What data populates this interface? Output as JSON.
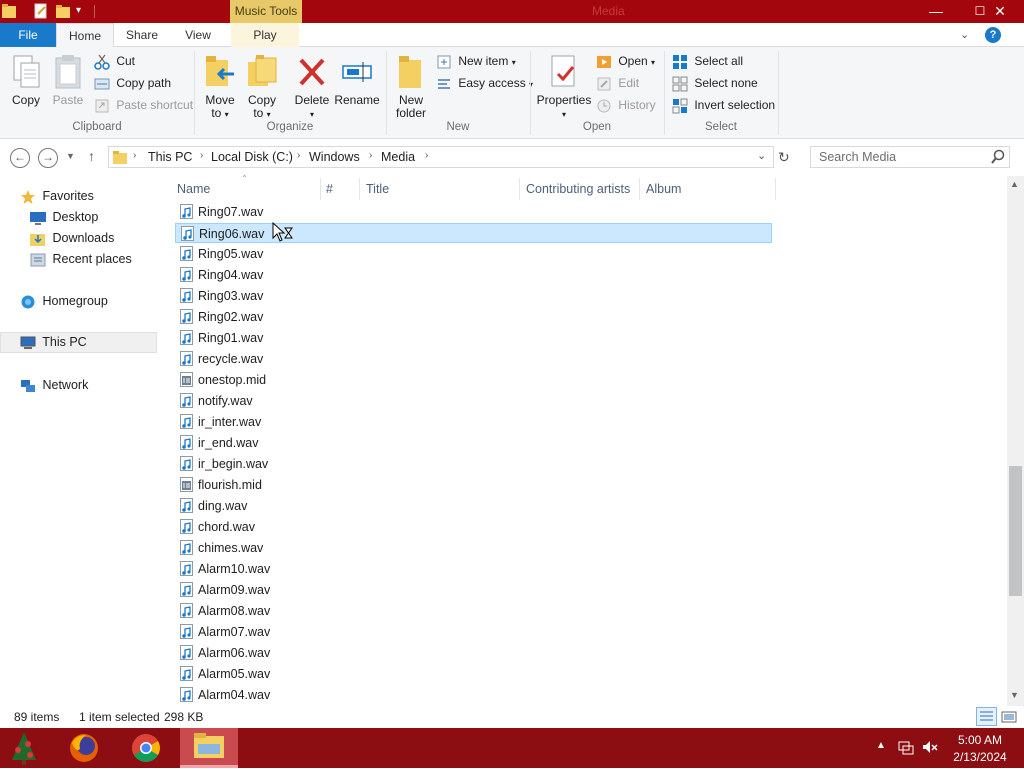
{
  "window": {
    "title": "Media",
    "contextual_tab_group": "Music Tools",
    "controls": {
      "minimize": "—",
      "maximize": "☐",
      "close": "✕"
    }
  },
  "ribbon_tabs": [
    "File",
    "Home",
    "Share",
    "View",
    "Play"
  ],
  "help_icon": "?",
  "ribbon": {
    "clipboard": {
      "label": "Clipboard",
      "copy": "Copy",
      "paste": "Paste",
      "cut": "Cut",
      "copy_path": "Copy path",
      "paste_shortcut": "Paste shortcut"
    },
    "organize": {
      "label": "Organize",
      "move_to": "Move",
      "move_to_2": "to",
      "copy_to": "Copy",
      "copy_to_2": "to",
      "delete": "Delete",
      "rename": "Rename"
    },
    "new": {
      "label": "New",
      "new_folder": "New",
      "new_folder_2": "folder",
      "new_item": "New item",
      "easy_access": "Easy access"
    },
    "open": {
      "label": "Open",
      "properties": "Properties",
      "open": "Open",
      "edit": "Edit",
      "history": "History"
    },
    "select": {
      "label": "Select",
      "select_all": "Select all",
      "select_none": "Select none",
      "invert_selection": "Invert selection"
    }
  },
  "address": {
    "breadcrumbs": [
      "This PC",
      "Local Disk (C:)",
      "Windows",
      "Media"
    ],
    "search_placeholder": "Search Media"
  },
  "nav": {
    "favorites": "Favorites",
    "desktop": "Desktop",
    "downloads": "Downloads",
    "recent_places": "Recent places",
    "homegroup": "Homegroup",
    "this_pc": "This PC",
    "network": "Network"
  },
  "columns": {
    "name": "Name",
    "number": "#",
    "title": "Title",
    "contributing_artists": "Contributing artists",
    "album": "Album"
  },
  "files": [
    {
      "name": "Ring07.wav",
      "type": "wav"
    },
    {
      "name": "Ring06.wav",
      "type": "wav",
      "selected": true
    },
    {
      "name": "Ring05.wav",
      "type": "wav"
    },
    {
      "name": "Ring04.wav",
      "type": "wav"
    },
    {
      "name": "Ring03.wav",
      "type": "wav"
    },
    {
      "name": "Ring02.wav",
      "type": "wav"
    },
    {
      "name": "Ring01.wav",
      "type": "wav"
    },
    {
      "name": "recycle.wav",
      "type": "wav"
    },
    {
      "name": "onestop.mid",
      "type": "mid"
    },
    {
      "name": "notify.wav",
      "type": "wav"
    },
    {
      "name": "ir_inter.wav",
      "type": "wav"
    },
    {
      "name": "ir_end.wav",
      "type": "wav"
    },
    {
      "name": "ir_begin.wav",
      "type": "wav"
    },
    {
      "name": "flourish.mid",
      "type": "mid"
    },
    {
      "name": "ding.wav",
      "type": "wav"
    },
    {
      "name": "chord.wav",
      "type": "wav"
    },
    {
      "name": "chimes.wav",
      "type": "wav"
    },
    {
      "name": "Alarm10.wav",
      "type": "wav"
    },
    {
      "name": "Alarm09.wav",
      "type": "wav"
    },
    {
      "name": "Alarm08.wav",
      "type": "wav"
    },
    {
      "name": "Alarm07.wav",
      "type": "wav"
    },
    {
      "name": "Alarm06.wav",
      "type": "wav"
    },
    {
      "name": "Alarm05.wav",
      "type": "wav"
    },
    {
      "name": "Alarm04.wav",
      "type": "wav"
    }
  ],
  "status": {
    "item_count": "89 items",
    "selection": "1 item selected",
    "size": "298 KB"
  },
  "taskbar": {
    "apps": [
      "tree-app-icon",
      "firefox-icon",
      "chrome-icon",
      "file-explorer-icon"
    ],
    "time": "5:00 AM",
    "date": "2/13/2024"
  },
  "colors": {
    "titlebar": "#a3070d",
    "taskbar": "#8c0d12",
    "file_tab": "#1979ca",
    "music_tools": "#e7c96a",
    "selection_fill": "#cce8ff",
    "selection_border": "#99d1ff"
  }
}
